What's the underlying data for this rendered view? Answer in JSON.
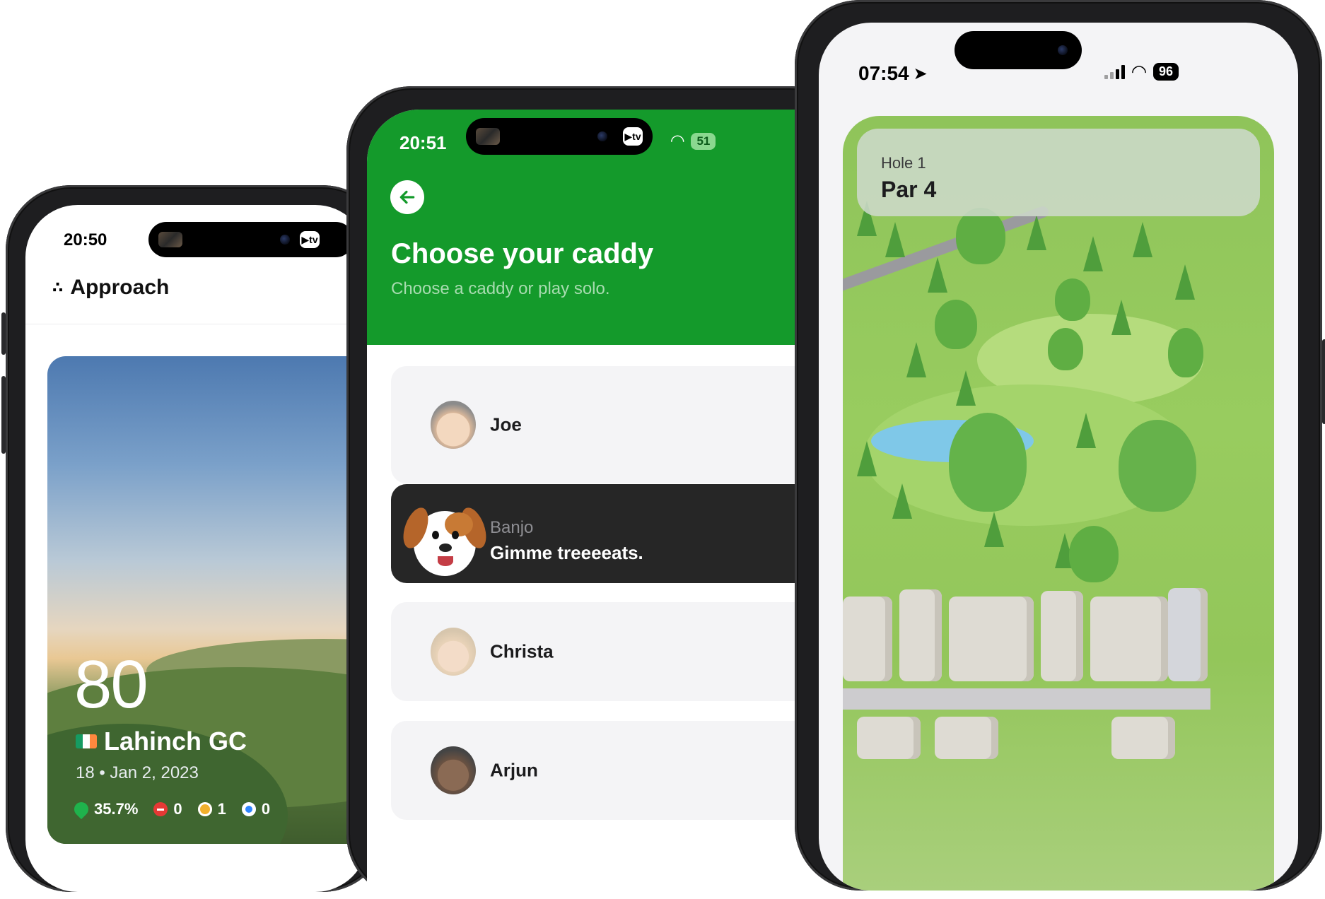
{
  "phone1": {
    "time": "20:50",
    "app_title": "Approach",
    "round": {
      "score": "80",
      "course": "Lahinch GC",
      "meta": "18 • Jan 2, 2023",
      "stats": [
        {
          "icon": "fairway-pin-icon",
          "value": "35.7%",
          "color": "#1fb34c"
        },
        {
          "icon": "minus-circle-icon",
          "value": "0",
          "color": "#e53935"
        },
        {
          "icon": "sun-icon",
          "value": "1",
          "color": "#f2b02c"
        },
        {
          "icon": "target-icon",
          "value": "0",
          "color": "#2e86ff"
        }
      ]
    }
  },
  "phone2": {
    "time": "20:51",
    "battery": "51",
    "title": "Choose your caddy",
    "subtitle": "Choose a caddy or play solo.",
    "caddies": [
      {
        "name": "Joe",
        "selected": false
      },
      {
        "name": "Banjo",
        "tagline": "Gimme treeeeats.",
        "selected": true
      },
      {
        "name": "Christa",
        "selected": false
      },
      {
        "name": "Arjun",
        "selected": false
      }
    ]
  },
  "phone3": {
    "time": "07:54",
    "battery": "96",
    "hole_label": "Hole 1",
    "par_label": "Par 4"
  }
}
